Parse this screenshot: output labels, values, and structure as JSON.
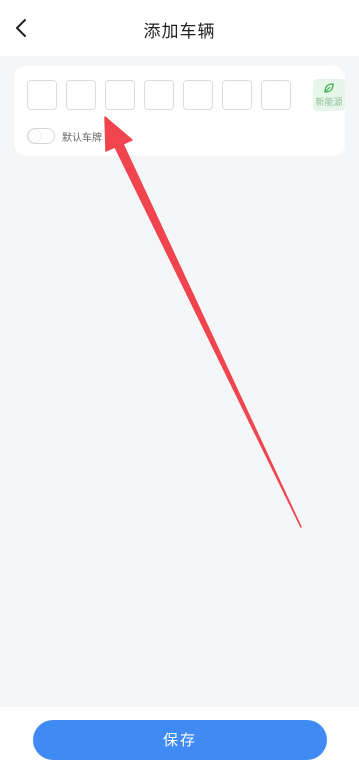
{
  "header": {
    "back_icon": "chevron-left-icon",
    "title": "添加车辆"
  },
  "plate": {
    "input_count": 7,
    "new_energy_icon": "leaf-icon",
    "new_energy_label": "新能源",
    "new_energy_color": "#e6f7e9"
  },
  "default_toggle": {
    "label": "默认车牌",
    "on": false
  },
  "footer": {
    "save_label": "保存",
    "accent_color": "#3f8bf3"
  },
  "annotation": {
    "arrow_color": "#f0454e"
  }
}
